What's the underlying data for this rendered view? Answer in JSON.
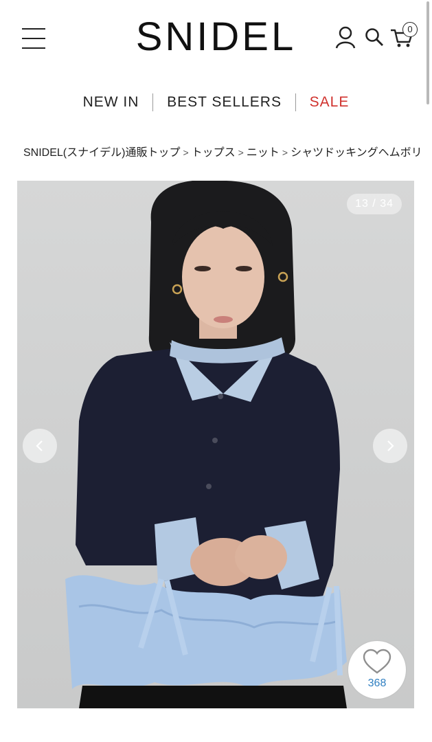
{
  "header": {
    "logo": "SNIDEL",
    "cart_count": "0"
  },
  "nav": {
    "items": [
      "NEW IN",
      "BEST SELLERS",
      "SALE"
    ]
  },
  "breadcrumb": {
    "items": [
      "SNIDEL(スナイデル)通販トップ",
      "トップス",
      "ニット",
      "シャツドッキングヘムボリ"
    ],
    "separator": ">"
  },
  "gallery": {
    "counter": "13 / 34",
    "favorite_count": "368"
  },
  "colors": {
    "sale": "#d0312d",
    "favorite_count": "#2f7fc1"
  }
}
